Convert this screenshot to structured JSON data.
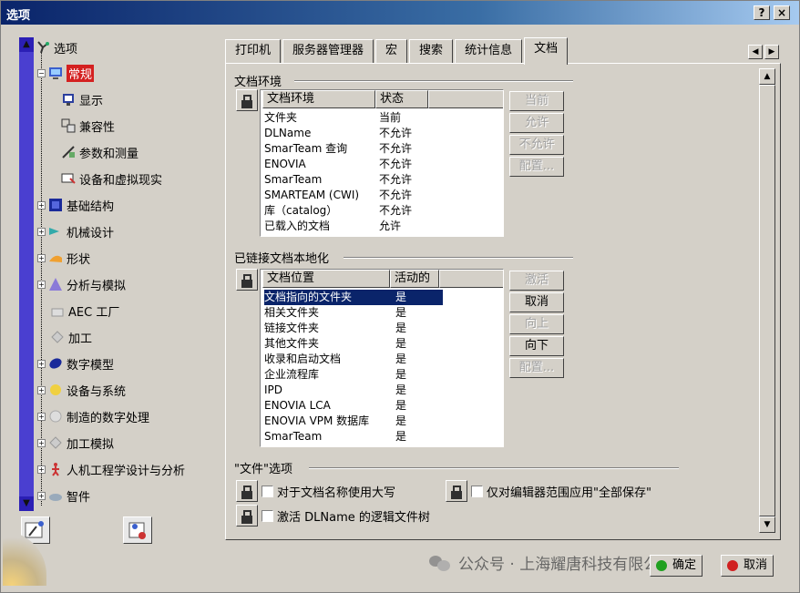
{
  "window": {
    "title": "选项",
    "help_label": "?",
    "close_label": "×"
  },
  "tree": {
    "items": [
      {
        "label": "选项",
        "icon": "options-root-icon"
      },
      {
        "label": "常规",
        "icon": "general-icon",
        "selected": true
      },
      {
        "label": "显示",
        "icon": "display-icon"
      },
      {
        "label": "兼容性",
        "icon": "compatibility-icon"
      },
      {
        "label": "参数和测量",
        "icon": "parameters-icon"
      },
      {
        "label": "设备和虚拟现实",
        "icon": "devices-icon"
      },
      {
        "label": "基础结构",
        "icon": "infrastructure-icon"
      },
      {
        "label": "机械设计",
        "icon": "mechanical-design-icon"
      },
      {
        "label": "形状",
        "icon": "shape-icon"
      },
      {
        "label": "分析与模拟",
        "icon": "analysis-icon"
      },
      {
        "label": "AEC 工厂",
        "icon": "aec-plant-icon"
      },
      {
        "label": "加工",
        "icon": "machining-icon"
      },
      {
        "label": "数字模型",
        "icon": "digital-mockup-icon"
      },
      {
        "label": "设备与系统",
        "icon": "equipment-icon"
      },
      {
        "label": "制造的数字处理",
        "icon": "manufacturing-icon"
      },
      {
        "label": "加工模拟",
        "icon": "machining-simulation-icon"
      },
      {
        "label": "人机工程学设计与分析",
        "icon": "ergonomics-icon"
      },
      {
        "label": "智件",
        "icon": "smartware-icon"
      }
    ],
    "scroll_up": "▲",
    "scroll_down": "▼"
  },
  "tabs": [
    {
      "label": "打印机"
    },
    {
      "label": "服务器管理器"
    },
    {
      "label": "宏"
    },
    {
      "label": "搜索"
    },
    {
      "label": "统计信息"
    },
    {
      "label": "文档",
      "active": true
    }
  ],
  "tab_scroll": {
    "left": "◀",
    "right": "▶"
  },
  "doc_env": {
    "group_title": "文档环境",
    "col1": "文档环境",
    "col2": "状态",
    "rows": [
      {
        "name": "文件夹",
        "status": "当前"
      },
      {
        "name": "DLName",
        "status": "不允许"
      },
      {
        "name": "SmarTeam 查询",
        "status": "不允许"
      },
      {
        "name": "ENOVIA",
        "status": "不允许"
      },
      {
        "name": "SmarTeam",
        "status": "不允许"
      },
      {
        "name": "SMARTEAM (CWI)",
        "status": "不允许"
      },
      {
        "name": "库（catalog）",
        "status": "不允许"
      },
      {
        "name": "已载入的文档",
        "status": "允许"
      }
    ],
    "buttons": [
      "当前",
      "允许",
      "不允许",
      "配置..."
    ]
  },
  "linked_doc": {
    "group_title": "已链接文档本地化",
    "col1": "文档位置",
    "col2": "活动的",
    "rows": [
      {
        "name": "文档指向的文件夹",
        "active": "是",
        "selected": true
      },
      {
        "name": "相关文件夹",
        "active": "是"
      },
      {
        "name": "链接文件夹",
        "active": "是"
      },
      {
        "name": "其他文件夹",
        "active": "是"
      },
      {
        "name": "收录和启动文档",
        "active": "是"
      },
      {
        "name": "企业流程库",
        "active": "是"
      },
      {
        "name": "IPD",
        "active": "是"
      },
      {
        "name": "ENOVIA LCA",
        "active": "是"
      },
      {
        "name": "ENOVIA VPM 数据库",
        "active": "是"
      },
      {
        "name": "SmarTeam",
        "active": "是"
      }
    ],
    "buttons": [
      "激活",
      "取消",
      "向上",
      "向下",
      "配置..."
    ]
  },
  "file_options": {
    "group_title": "\"文件\"选项",
    "uppercase_label": "对于文档名称使用大写",
    "save_all_label": "仅对编辑器范围应用\"全部保存\"",
    "dlname_label": "激活 DLName 的逻辑文件树"
  },
  "footer": {
    "ok_label": "确定",
    "cancel_label": "取消"
  },
  "watermark": {
    "text": "公众号 · 上海耀唐科技有限公司"
  },
  "colors": {
    "titlebar": "#0a246a",
    "selection": "#0a246a",
    "tree_selected": "#d42020",
    "ok_dot": "#20a020",
    "cancel_dot": "#d02020"
  }
}
